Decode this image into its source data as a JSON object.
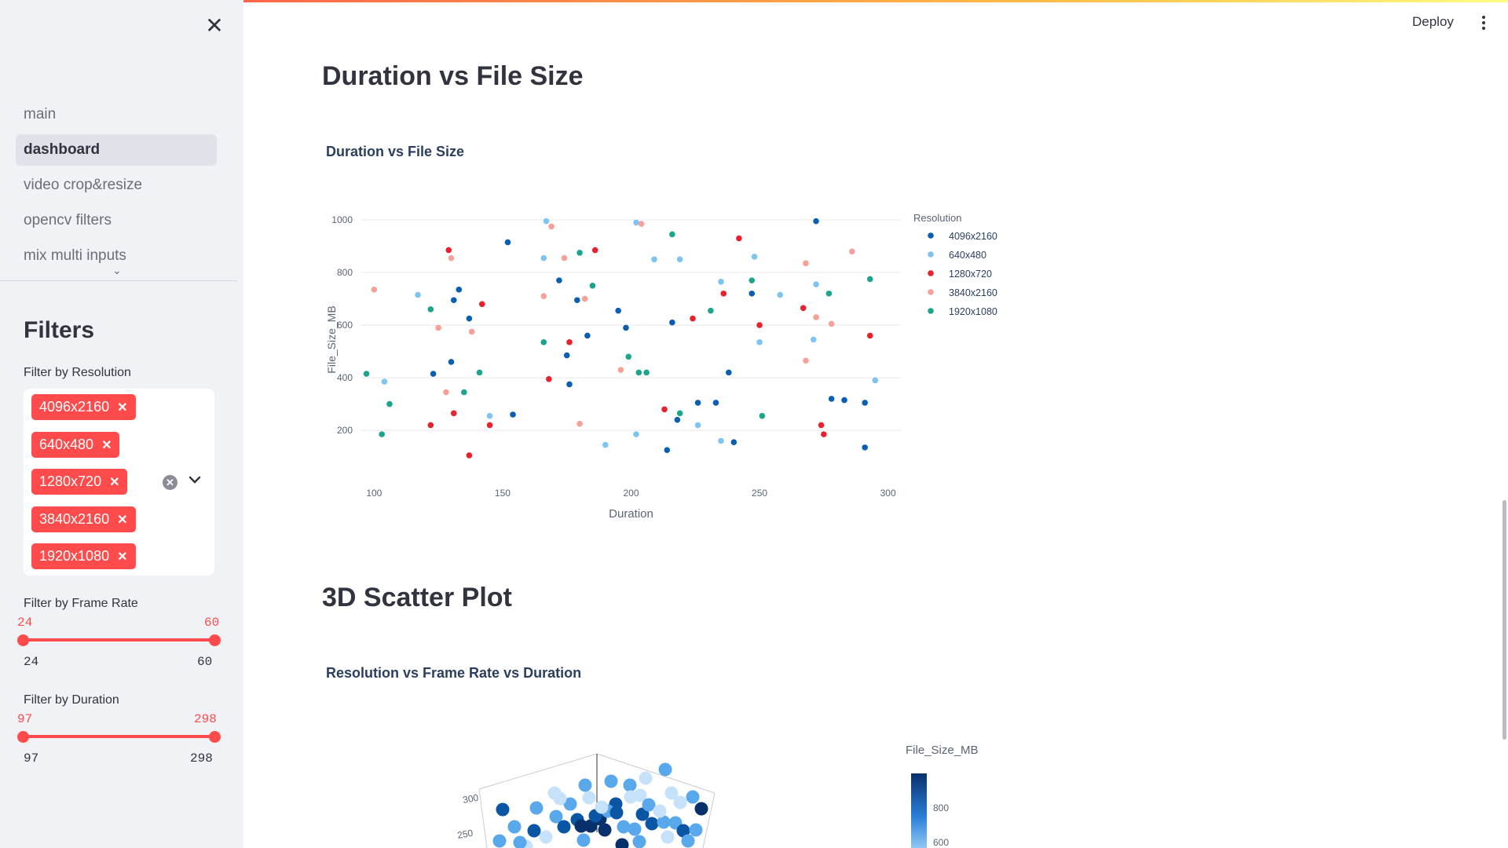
{
  "sidebar": {
    "nav_items": [
      {
        "label": "main",
        "active": false
      },
      {
        "label": "dashboard",
        "active": true
      },
      {
        "label": "video crop&resize",
        "active": false
      },
      {
        "label": "opencv filters",
        "active": false
      },
      {
        "label": "mix multi inputs",
        "active": false
      }
    ],
    "filters_title": "Filters",
    "resolution_filter": {
      "label": "Filter by Resolution",
      "selected": [
        "4096x2160",
        "640x480",
        "1280x720",
        "3840x2160",
        "1920x1080"
      ]
    },
    "frame_rate_filter": {
      "label": "Filter by Frame Rate",
      "value_low": "24",
      "value_high": "60",
      "min": "24",
      "max": "60"
    },
    "duration_filter": {
      "label": "Filter by Duration",
      "value_low": "97",
      "value_high": "298",
      "min": "97",
      "max": "298"
    }
  },
  "header": {
    "deploy_label": "Deploy"
  },
  "main": {
    "section1_heading": "Duration vs File Size",
    "chart1_title": "Duration vs File Size",
    "section2_heading": "3D Scatter Plot",
    "chart2_title": "Resolution vs Frame Rate vs Duration"
  },
  "colors": {
    "accent": "#ff4b4b",
    "series": {
      "4096x2160": "#0a5fb4",
      "640x480": "#7ec4f0",
      "1280x720": "#e8222c",
      "3840x2160": "#f7a09a",
      "1920x1080": "#1ca58c"
    }
  },
  "chart_data": [
    {
      "type": "scatter",
      "title": "Duration vs File Size",
      "xlabel": "Duration",
      "ylabel": "File_Size_MB",
      "xlim": [
        95,
        305
      ],
      "ylim": [
        60,
        1030
      ],
      "xticks": [
        "100",
        "150",
        "200",
        "250",
        "300"
      ],
      "yticks": [
        "200",
        "400",
        "600",
        "800",
        "1000"
      ],
      "legend_title": "Resolution",
      "legend_position": "right",
      "grid": true,
      "series": [
        {
          "name": "4096x2160",
          "color": "#0a5fb4",
          "points": [
            [
              130,
              460
            ],
            [
              131,
              695
            ],
            [
              133,
              735
            ],
            [
              137,
              625
            ],
            [
              152,
              915
            ],
            [
              154,
              260
            ],
            [
              172,
              770
            ],
            [
              175,
              485
            ],
            [
              176,
              375
            ],
            [
              179,
              695
            ],
            [
              183,
              560
            ],
            [
              195,
              655
            ],
            [
              198,
              590
            ],
            [
              214,
              125
            ],
            [
              216,
              610
            ],
            [
              218,
              240
            ],
            [
              226,
              305
            ],
            [
              233,
              305
            ],
            [
              238,
              420
            ],
            [
              240,
              155
            ],
            [
              247,
              720
            ],
            [
              272,
              995
            ],
            [
              278,
              320
            ],
            [
              283,
              315
            ],
            [
              291,
              305
            ],
            [
              291,
              135
            ],
            [
              123,
              415
            ]
          ]
        },
        {
          "name": "640x480",
          "color": "#7ec4f0",
          "points": [
            [
              104,
              385
            ],
            [
              117,
              715
            ],
            [
              145,
              255
            ],
            [
              166,
              855
            ],
            [
              167,
              995
            ],
            [
              190,
              145
            ],
            [
              202,
              990
            ],
            [
              202,
              185
            ],
            [
              209,
              850
            ],
            [
              219,
              850
            ],
            [
              226,
              220
            ],
            [
              235,
              765
            ],
            [
              235,
              160
            ],
            [
              248,
              860
            ],
            [
              250,
              535
            ],
            [
              258,
              715
            ],
            [
              271,
              545
            ],
            [
              272,
              755
            ],
            [
              295,
              390
            ]
          ]
        },
        {
          "name": "1280x720",
          "color": "#e8222c",
          "points": [
            [
              122,
              220
            ],
            [
              129,
              885
            ],
            [
              131,
              265
            ],
            [
              137,
              105
            ],
            [
              142,
              680
            ],
            [
              145,
              220
            ],
            [
              168,
              395
            ],
            [
              176,
              535
            ],
            [
              186,
              885
            ],
            [
              213,
              280
            ],
            [
              224,
              625
            ],
            [
              236,
              720
            ],
            [
              242,
              930
            ],
            [
              250,
              600
            ],
            [
              267,
              665
            ],
            [
              274,
              220
            ],
            [
              275,
              185
            ],
            [
              293,
              560
            ]
          ]
        },
        {
          "name": "3840x2160",
          "color": "#f7a09a",
          "points": [
            [
              100,
              735
            ],
            [
              125,
              590
            ],
            [
              128,
              345
            ],
            [
              130,
              855
            ],
            [
              138,
              575
            ],
            [
              166,
              710
            ],
            [
              169,
              975
            ],
            [
              174,
              855
            ],
            [
              182,
              700
            ],
            [
              180,
              225
            ],
            [
              196,
              430
            ],
            [
              204,
              985
            ],
            [
              268,
              835
            ],
            [
              268,
              465
            ],
            [
              272,
              630
            ],
            [
              278,
              605
            ],
            [
              286,
              880
            ]
          ]
        },
        {
          "name": "1920x1080",
          "color": "#1ca58c",
          "points": [
            [
              97,
              415
            ],
            [
              103,
              185
            ],
            [
              106,
              300
            ],
            [
              122,
              660
            ],
            [
              135,
              345
            ],
            [
              141,
              420
            ],
            [
              166,
              535
            ],
            [
              180,
              875
            ],
            [
              185,
              750
            ],
            [
              199,
              480
            ],
            [
              203,
              420
            ],
            [
              206,
              420
            ],
            [
              216,
              945
            ],
            [
              219,
              265
            ],
            [
              231,
              655
            ],
            [
              247,
              770
            ],
            [
              251,
              255
            ],
            [
              277,
              720
            ],
            [
              293,
              775
            ]
          ]
        }
      ]
    },
    {
      "type": "scatter",
      "title": "Resolution vs Frame Rate vs Duration",
      "colorbar_title": "File_Size_MB",
      "colorbar_ticks": [
        "800",
        "600"
      ],
      "visible_axis_ticks": [
        "300",
        "250"
      ],
      "colorscale": [
        "#c6e2fb",
        "#5aa8ec",
        "#0b56a4",
        "#08306b"
      ]
    }
  ]
}
